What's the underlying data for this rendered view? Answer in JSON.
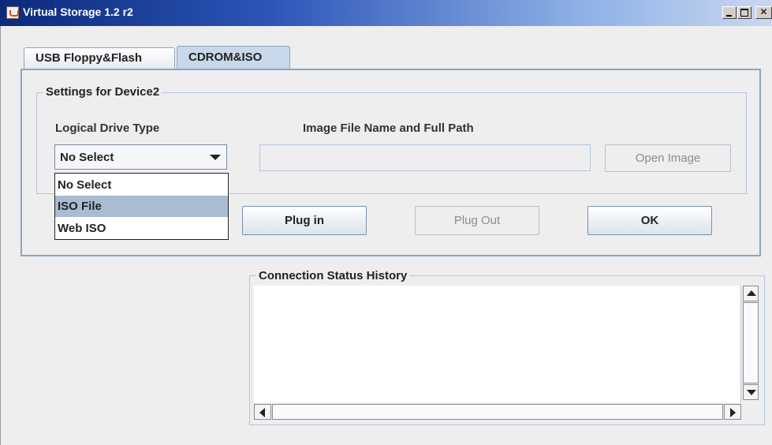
{
  "window": {
    "title": "Virtual Storage 1.2 r2",
    "icon": "java-cup-icon",
    "controls": [
      "minimize",
      "maximize",
      "close"
    ]
  },
  "tabs": [
    {
      "label": "USB Floppy&Flash",
      "selected": false
    },
    {
      "label": "CDROM&ISO",
      "selected": true
    }
  ],
  "settings": {
    "legend": "Settings for Device2",
    "drive_type_label": "Logical Drive Type",
    "image_path_label": "Image File Name and Full Path",
    "drive_type_value": "No Select",
    "image_path_value": "",
    "dropdown_options": [
      "No Select",
      "ISO File",
      "Web ISO"
    ],
    "dropdown_highlighted": "ISO File",
    "open_image_label": "Open Image"
  },
  "actions": {
    "plug_in": "Plug in",
    "plug_out": "Plug Out",
    "ok": "OK"
  },
  "status": {
    "legend": "Connection Status History",
    "history_text": ""
  },
  "colors": {
    "titlebar_start": "#0b2a7a",
    "titlebar_end": "#c9d8f0",
    "selected_tab": "#c7d8ea",
    "panel_border": "#88a6c9",
    "highlight": "#a8bcd2"
  }
}
